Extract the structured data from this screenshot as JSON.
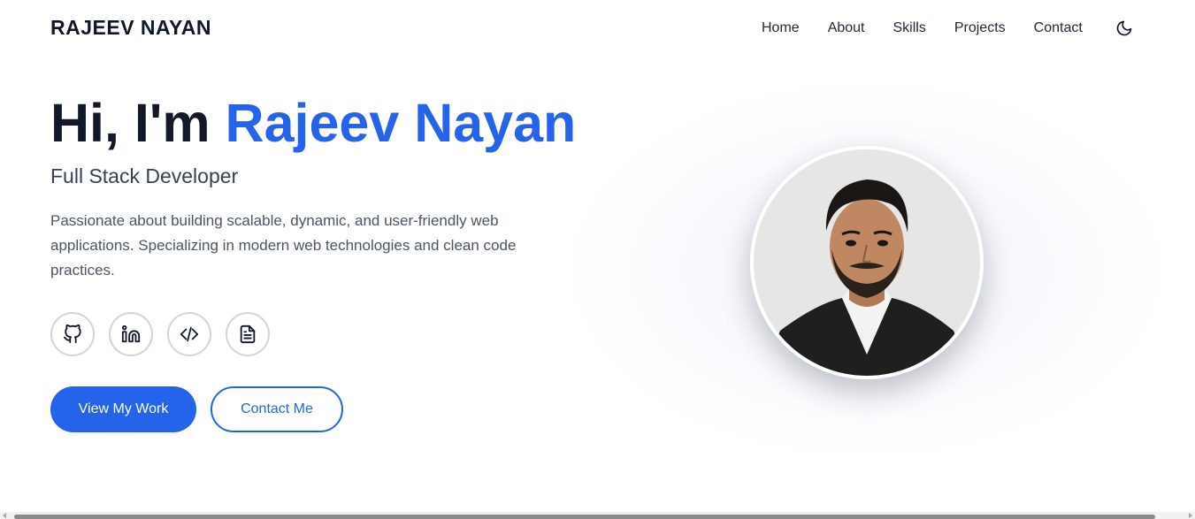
{
  "header": {
    "brand": "RAJEEV NAYAN",
    "nav": [
      {
        "label": "Home"
      },
      {
        "label": "About"
      },
      {
        "label": "Skills"
      },
      {
        "label": "Projects"
      },
      {
        "label": "Contact"
      }
    ],
    "theme_toggle_icon": "moon-icon"
  },
  "hero": {
    "greeting": "Hi, I'm ",
    "name": "Rajeev Nayan",
    "subtitle": "Full Stack Developer",
    "description": "Passionate about building scalable, dynamic, and user-friendly web applications. Specializing in modern web technologies and clean code practices.",
    "social_icons": [
      "github-icon",
      "linkedin-icon",
      "code-icon",
      "document-icon"
    ],
    "primary_cta": "View My Work",
    "secondary_cta": "Contact Me"
  },
  "colors": {
    "accent": "#2563eb",
    "text_dark": "#111827",
    "text_muted": "#4b5563"
  }
}
